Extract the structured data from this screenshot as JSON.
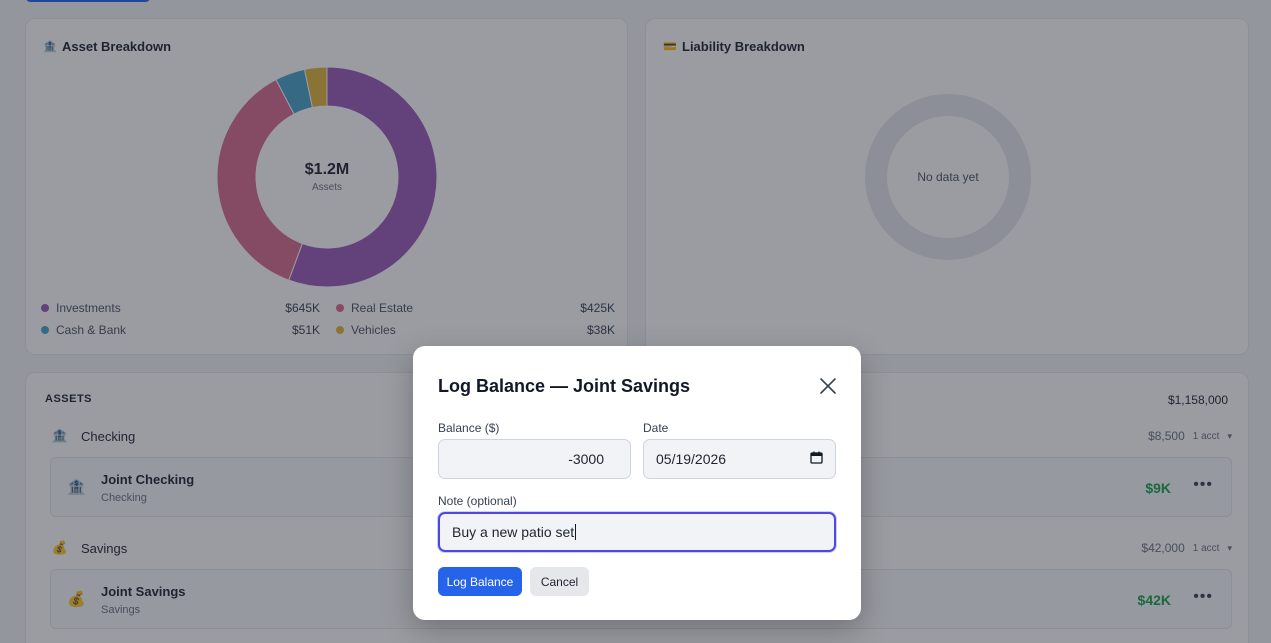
{
  "asset_card": {
    "title": "Asset Breakdown",
    "icon": "bank-icon",
    "center_value": "$1.2M",
    "center_label": "Assets"
  },
  "chart_data": {
    "type": "pie",
    "title": "Asset Breakdown",
    "categories": [
      "Investments",
      "Real Estate",
      "Cash & Bank",
      "Vehicles"
    ],
    "values": [
      645,
      425,
      51,
      38
    ],
    "value_labels": [
      "$645K",
      "$425K",
      "$51K",
      "$38K"
    ],
    "colors": [
      "#9b59b6",
      "#d96b8f",
      "#4aa3c8",
      "#e0b63a"
    ],
    "legend_position": "bottom"
  },
  "legend": [
    {
      "name": "Investments",
      "value": "$645K",
      "color": "#9b59b6"
    },
    {
      "name": "Real Estate",
      "value": "$425K",
      "color": "#d96b8f"
    },
    {
      "name": "Cash & Bank",
      "value": "$51K",
      "color": "#4aa3c8"
    },
    {
      "name": "Vehicles",
      "value": "$38K",
      "color": "#e0b63a"
    }
  ],
  "liability_card": {
    "title": "Liability Breakdown",
    "icon": "credit-card-icon",
    "empty_text": "No data yet"
  },
  "assets_section": {
    "header": "ASSETS",
    "total": "$1,158,000",
    "groups": [
      {
        "name": "Checking",
        "amount": "$8,500",
        "count": "1 acct",
        "chevron": "▾",
        "account": {
          "name": "Joint Checking",
          "type": "Checking",
          "value": "$9K",
          "more": "•••"
        }
      },
      {
        "name": "Savings",
        "amount": "$42,000",
        "count": "1 acct",
        "chevron": "▾",
        "account": {
          "name": "Joint Savings",
          "type": "Savings",
          "value": "$42K",
          "more": "•••"
        }
      }
    ]
  },
  "modal": {
    "title": "Log Balance — Joint Savings",
    "balance_label": "Balance ($)",
    "balance_value": "-3000",
    "date_label": "Date",
    "date_value": "05/19/2026",
    "note_label": "Note (optional)",
    "note_value": "Buy a new patio set",
    "submit_label": "Log Balance",
    "cancel_label": "Cancel"
  },
  "colors": {
    "accent": "#2563eb",
    "positive": "#16a34a",
    "focus": "#4f46e5"
  }
}
